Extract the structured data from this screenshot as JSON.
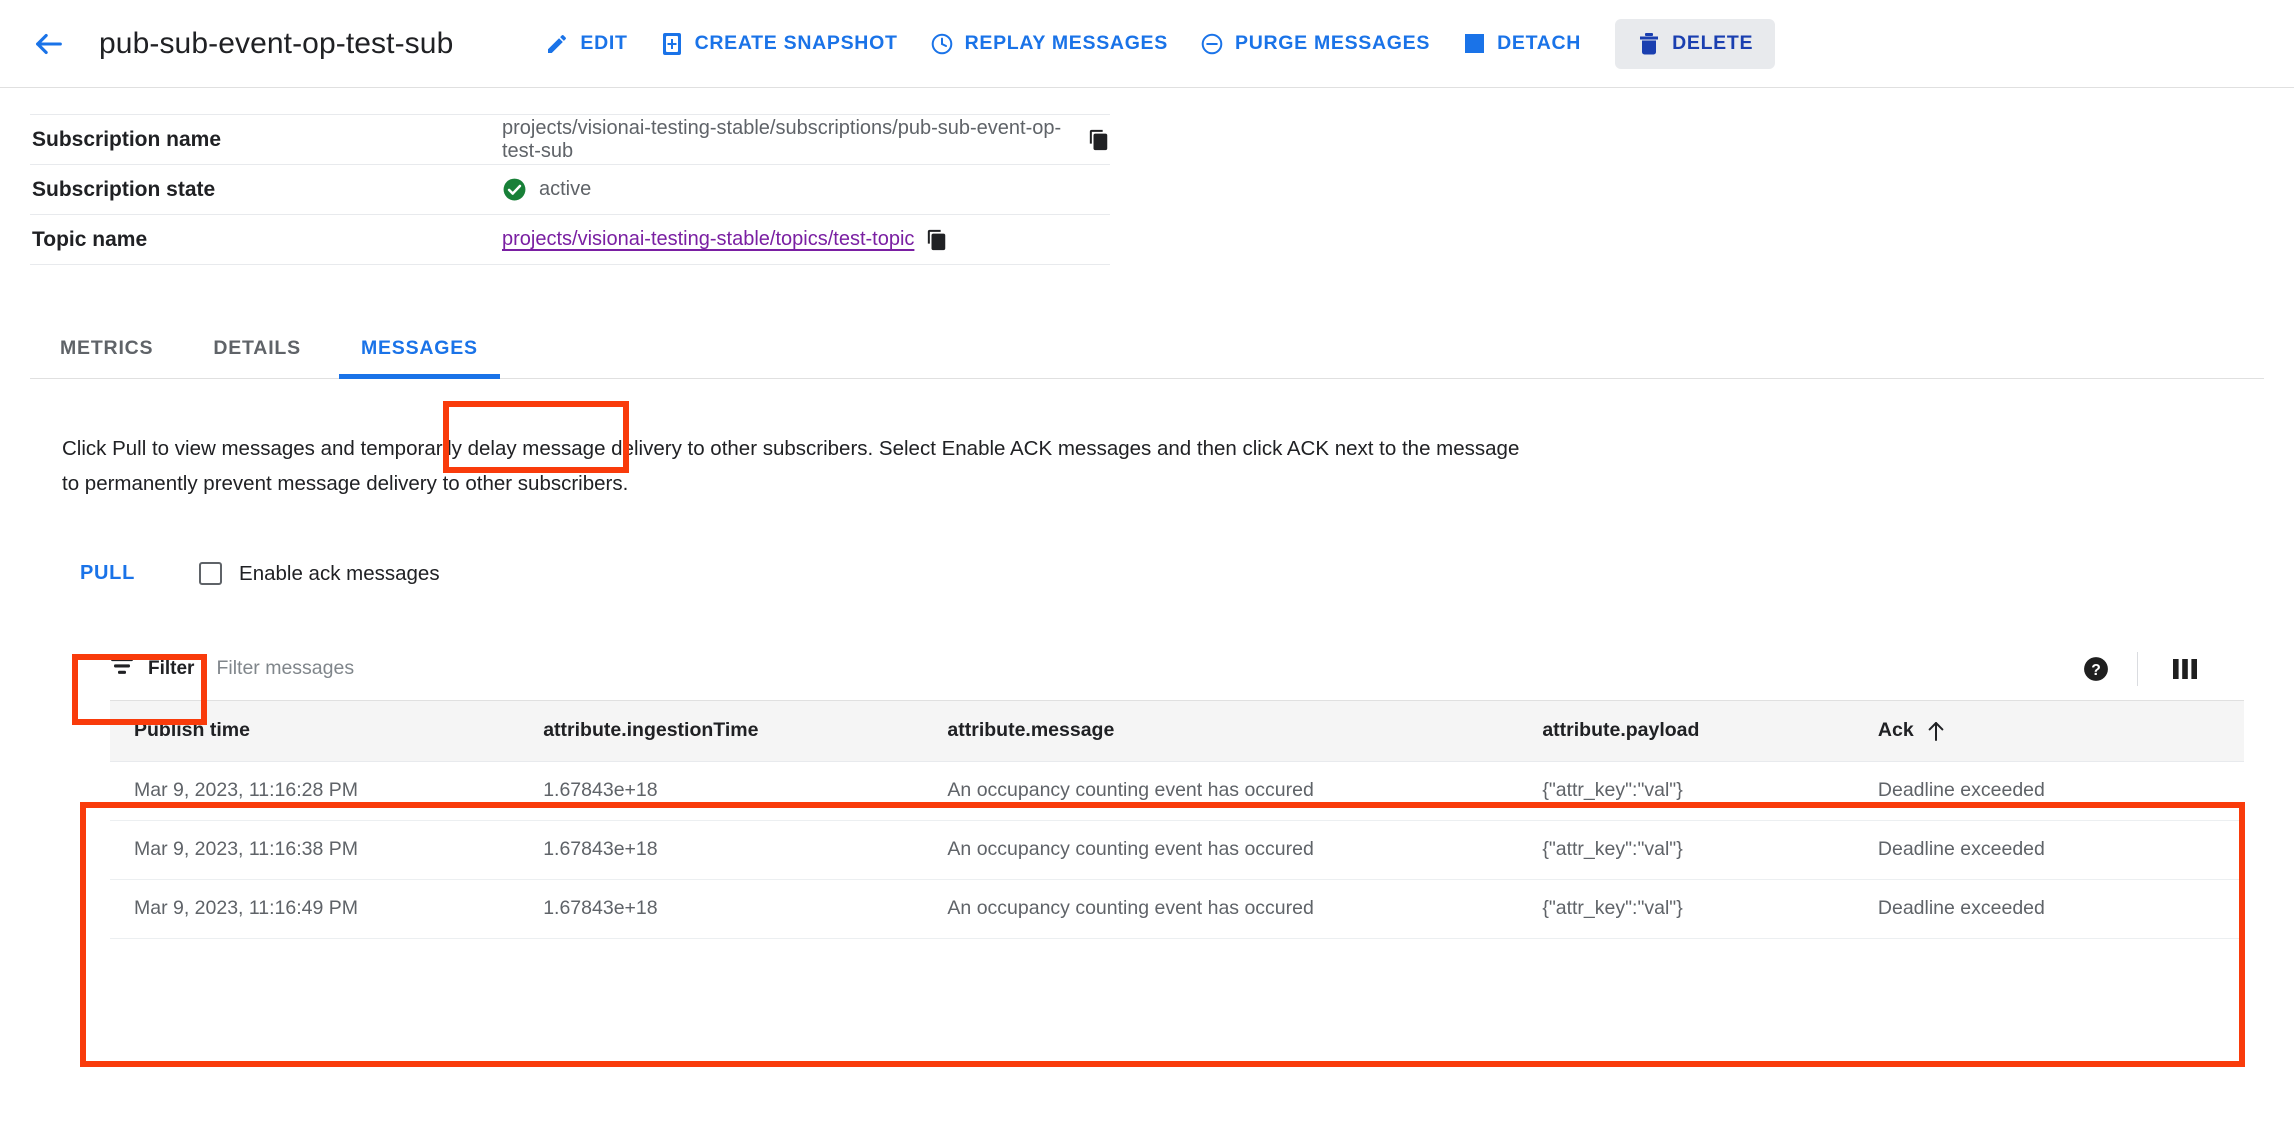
{
  "header": {
    "back_icon": "arrow-left-icon",
    "title": "pub-sub-event-op-test-sub",
    "actions": [
      {
        "label": "EDIT",
        "icon": "pencil-icon"
      },
      {
        "label": "CREATE SNAPSHOT",
        "icon": "snapshot-icon"
      },
      {
        "label": "REPLAY MESSAGES",
        "icon": "clock-icon"
      },
      {
        "label": "PURGE MESSAGES",
        "icon": "minus-circle-icon"
      },
      {
        "label": "DETACH",
        "icon": "square-icon"
      },
      {
        "label": "DELETE",
        "icon": "trash-icon"
      }
    ]
  },
  "info": {
    "rows": [
      {
        "key": "Subscription name",
        "value": "projects/visionai-testing-stable/subscriptions/pub-sub-event-op-test-sub",
        "copy": true,
        "type": "text"
      },
      {
        "key": "Subscription state",
        "value": "active",
        "type": "status",
        "status_color": "#188038"
      },
      {
        "key": "Topic name",
        "value": "projects/visionai-testing-stable/topics/test-topic ",
        "copy": true,
        "type": "link"
      }
    ]
  },
  "tabs": {
    "items": [
      {
        "label": "METRICS",
        "active": false
      },
      {
        "label": "DETAILS",
        "active": false
      },
      {
        "label": "MESSAGES",
        "active": true
      }
    ]
  },
  "messages_panel": {
    "description": "Click Pull to view messages and temporarily delay message delivery to other subscribers. Select Enable ACK messages and then click ACK next to the message to permanently prevent message delivery to other subscribers.",
    "pull_label": "PULL",
    "ack_checkbox_label": "Enable ack messages",
    "ack_checkbox_checked": false,
    "filter": {
      "label": "Filter",
      "placeholder": "Filter messages",
      "filter_icon": "filter-icon",
      "help_icon": "help-circle-icon",
      "columns_icon": "columns-icon"
    },
    "table": {
      "columns": [
        "Publish time",
        "attribute.ingestionTime",
        "attribute.message",
        "attribute.payload",
        "Ack"
      ],
      "sorted_column": "Ack",
      "sort_direction": "asc",
      "sort_icon": "arrow-up-icon",
      "rows": [
        {
          "publish_time": "Mar 9, 2023, 11:16:28 PM",
          "ingestion_time": "1.67843e+18",
          "message": "An occupancy counting event has occured",
          "payload": "{\"attr_key\":\"val\"}",
          "ack": "Deadline exceeded"
        },
        {
          "publish_time": "Mar 9, 2023, 11:16:38 PM",
          "ingestion_time": "1.67843e+18",
          "message": "An occupancy counting event has occured",
          "payload": "{\"attr_key\":\"val\"}",
          "ack": "Deadline exceeded"
        },
        {
          "publish_time": "Mar 9, 2023, 11:16:49 PM",
          "ingestion_time": "1.67843e+18",
          "message": "An occupancy counting event has occured",
          "payload": "{\"attr_key\":\"val\"}",
          "ack": "Deadline exceeded"
        }
      ]
    }
  },
  "colors": {
    "accent_blue": "#1a73e8",
    "link_purple": "#7a1fa2",
    "status_green": "#188038",
    "annotation_red": "#f93b0b",
    "delete_label": "#1a3fb0"
  }
}
